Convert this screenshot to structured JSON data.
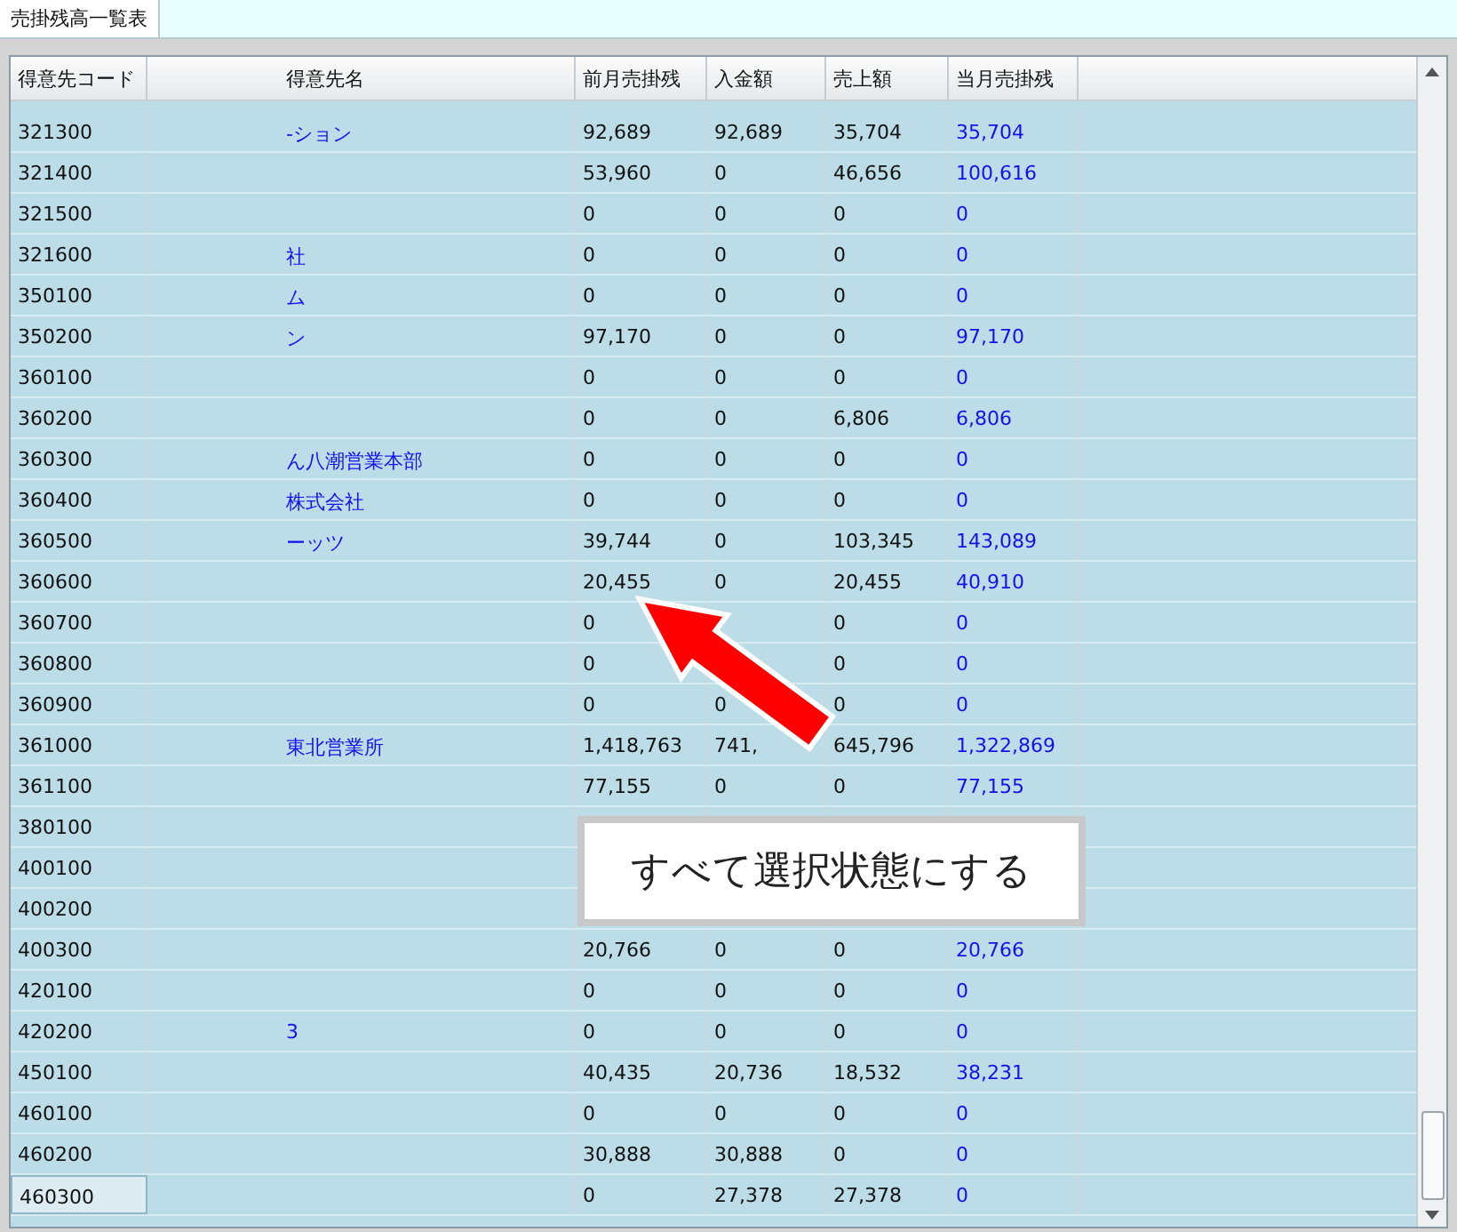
{
  "tab": {
    "label": "売掛残高一覧表",
    "selected": true
  },
  "columns": [
    "得意先コード",
    "得意先名",
    "前月売掛残",
    "入金額",
    "売上額",
    "当月売掛残"
  ],
  "rows": [
    {
      "code": "321300",
      "name": "-ション",
      "prev": "92,689",
      "paid": "92,689",
      "sales": "35,704",
      "current": "35,704"
    },
    {
      "code": "321400",
      "prev": "53,960",
      "paid": "0",
      "sales": "46,656",
      "current": "100,616"
    },
    {
      "code": "321500",
      "prev": "0",
      "paid": "0",
      "sales": "0",
      "current": "0"
    },
    {
      "code": "321600",
      "name": "社",
      "prev": "0",
      "paid": "0",
      "sales": "0",
      "current": "0"
    },
    {
      "code": "350100",
      "name": "ム",
      "prev": "0",
      "paid": "0",
      "sales": "0",
      "current": "0"
    },
    {
      "code": "350200",
      "name": "ン",
      "prev": "97,170",
      "paid": "0",
      "sales": "0",
      "current": "97,170"
    },
    {
      "code": "360100",
      "prev": "0",
      "paid": "0",
      "sales": "0",
      "current": "0"
    },
    {
      "code": "360200",
      "prev": "0",
      "paid": "0",
      "sales": "6,806",
      "current": "6,806"
    },
    {
      "code": "360300",
      "name": "ん八潮営業本部",
      "prev": "0",
      "paid": "0",
      "sales": "0",
      "current": "0"
    },
    {
      "code": "360400",
      "name": "株式会社",
      "prev": "0",
      "paid": "0",
      "sales": "0",
      "current": "0"
    },
    {
      "code": "360500",
      "name": "ーッツ",
      "prev": "39,744",
      "paid": "0",
      "sales": "103,345",
      "current": "143,089"
    },
    {
      "code": "360600",
      "prev": "20,455",
      "paid": "0",
      "sales": "20,455",
      "current": "40,910"
    },
    {
      "code": "360700",
      "prev": "0",
      "sales": "0",
      "current": "0"
    },
    {
      "code": "360800",
      "prev": "0",
      "sales": "0",
      "current": "0"
    },
    {
      "code": "360900",
      "prev": "0",
      "paid": "0",
      "sales": "0",
      "current": "0"
    },
    {
      "code": "361000",
      "name": "東北営業所",
      "prev": "1,418,763",
      "paid": "741,",
      "sales": "645,796",
      "current": "1,322,869"
    },
    {
      "code": "361100",
      "prev": "77,155",
      "paid": "0",
      "sales": "0",
      "current": "77,155"
    },
    {
      "code": "380100"
    },
    {
      "code": "400100"
    },
    {
      "code": "400200"
    },
    {
      "code": "400300",
      "prev": "20,766",
      "paid": "0",
      "sales": "0",
      "current": "20,766"
    },
    {
      "code": "420100",
      "prev": "0",
      "paid": "0",
      "sales": "0",
      "current": "0"
    },
    {
      "code": "420200",
      "name": "3",
      "prev": "0",
      "paid": "0",
      "sales": "0",
      "current": "0"
    },
    {
      "code": "450100",
      "prev": "40,435",
      "paid": "20,736",
      "sales": "18,532",
      "current": "38,231"
    },
    {
      "code": "460100",
      "prev": "0",
      "paid": "0",
      "sales": "0",
      "current": "0"
    },
    {
      "code": "460200",
      "prev": "30,888",
      "paid": "30,888",
      "sales": "0",
      "current": "0"
    },
    {
      "code": "460300",
      "focused": true,
      "prev": "0",
      "paid": "27,378",
      "sales": "27,378",
      "current": "0"
    }
  ],
  "callout": "すべて選択状態にする"
}
